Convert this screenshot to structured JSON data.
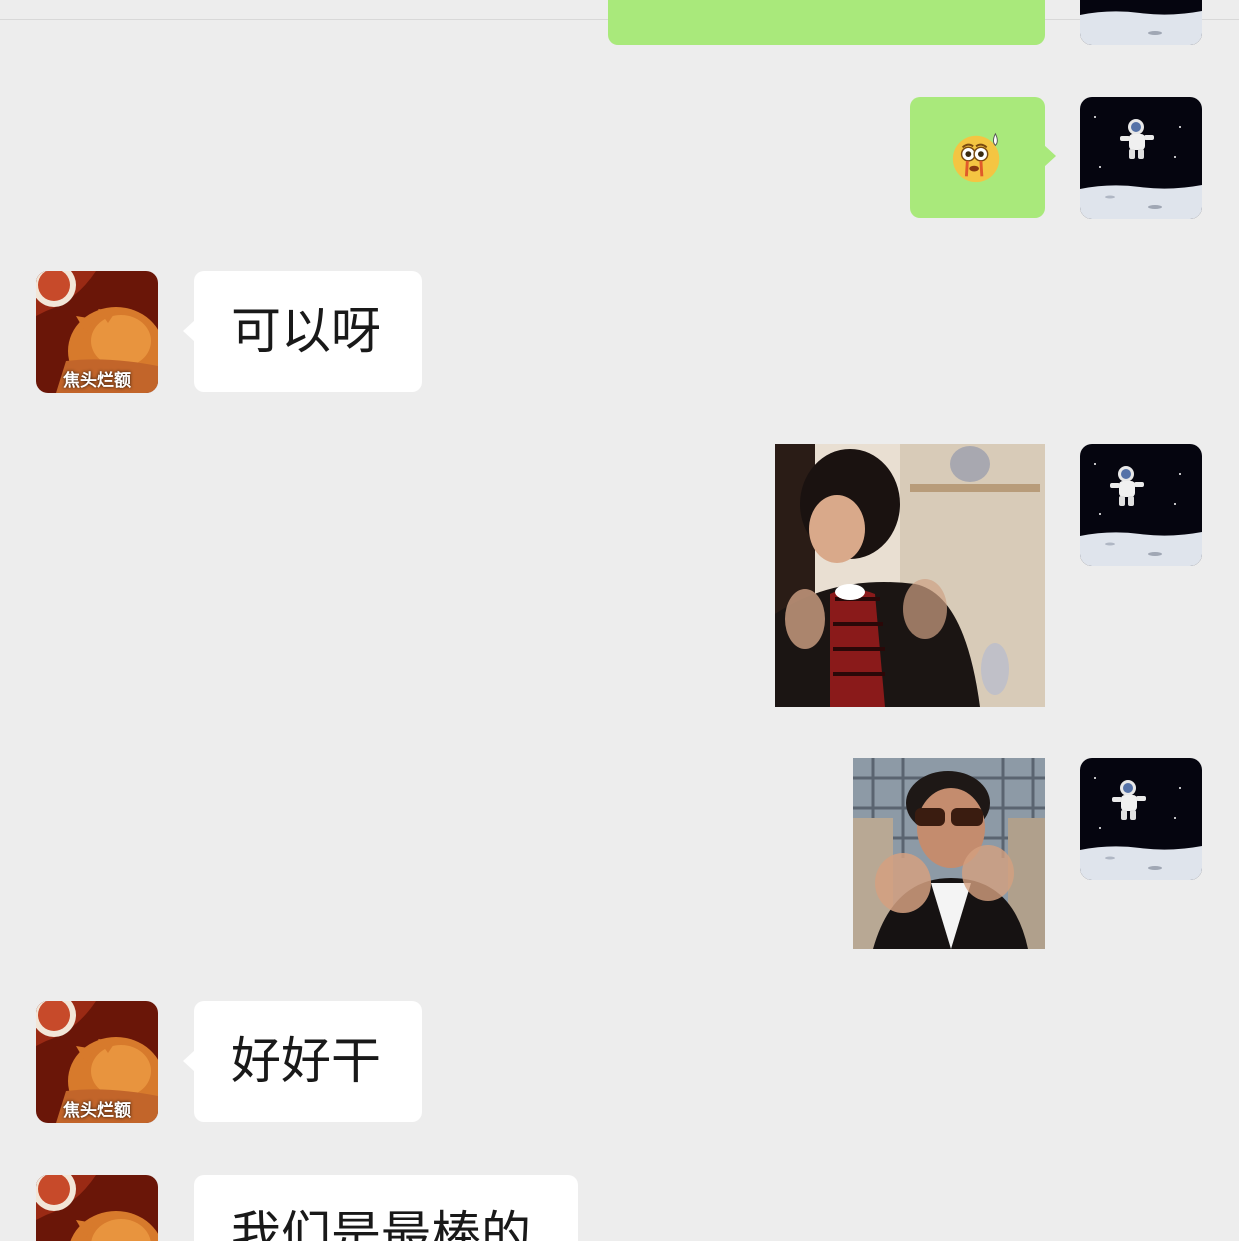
{
  "conversation": {
    "messages": [
      {
        "side": "right",
        "kind": "text",
        "text": ""
      },
      {
        "side": "right",
        "kind": "emoji",
        "emoji": "scared-crying-face-emoji"
      },
      {
        "side": "left",
        "kind": "text",
        "avatar_label": "焦头烂额",
        "text": "可以呀"
      },
      {
        "side": "right",
        "kind": "image",
        "image": "man-waving-hands-gif"
      },
      {
        "side": "right",
        "kind": "image",
        "image": "man-sunglasses-waving-gif"
      },
      {
        "side": "left",
        "kind": "text",
        "avatar_label": "焦头烂额",
        "text": "好好干"
      },
      {
        "side": "left",
        "kind": "text",
        "avatar_label": "",
        "text": "我们是最棒的"
      }
    ]
  },
  "colors": {
    "background": "#ededed",
    "outgoing_bubble": "#a9e97b",
    "incoming_bubble": "#ffffff",
    "text": "#191919"
  },
  "icons": {
    "self_avatar": "astronaut-on-moon-avatar",
    "contact_avatar": "cat-avatar"
  }
}
